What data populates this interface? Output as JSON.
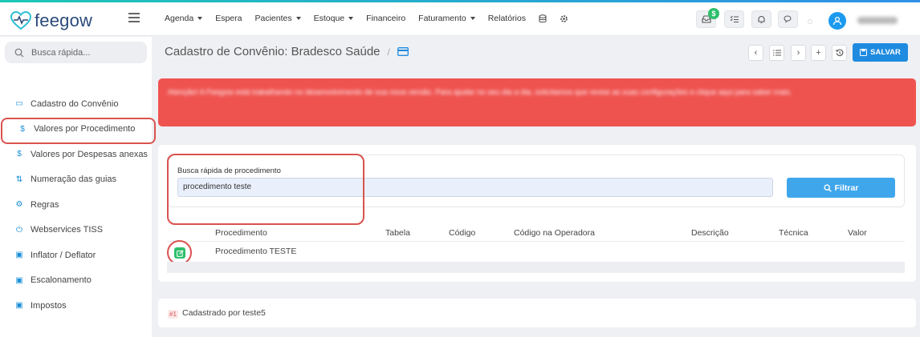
{
  "app": {
    "logo_text": "feegow"
  },
  "topnav": [
    {
      "label": "Agenda",
      "dropdown": true
    },
    {
      "label": "Espera",
      "dropdown": false
    },
    {
      "label": "Pacientes",
      "dropdown": true
    },
    {
      "label": "Estoque",
      "dropdown": true
    },
    {
      "label": "Financeiro",
      "dropdown": false
    },
    {
      "label": "Faturamento",
      "dropdown": true
    },
    {
      "label": "Relatórios",
      "dropdown": false
    }
  ],
  "topbar": {
    "notification_badge": "$"
  },
  "sidebar": {
    "search_placeholder": "Busca rápida...",
    "items": [
      {
        "label": "Cadastro do Convênio",
        "icon": "card-icon",
        "glyph": "▭",
        "active": false
      },
      {
        "label": "Valores por Procedimento",
        "icon": "dollar-icon",
        "glyph": "$",
        "active": true
      },
      {
        "label": "Valores por Despesas anexas",
        "icon": "dollar-icon",
        "glyph": "$",
        "active": false
      },
      {
        "label": "Numeração das guias",
        "icon": "sort-icon",
        "glyph": "⇅",
        "active": false
      },
      {
        "label": "Regras",
        "icon": "cogs-icon",
        "glyph": "⚙",
        "active": false
      },
      {
        "label": "Webservices TISS",
        "icon": "plug-icon",
        "glyph": "⏻",
        "active": false
      },
      {
        "label": "Inflator / Deflator",
        "icon": "money-icon",
        "glyph": "▣",
        "active": false
      },
      {
        "label": "Escalonamento",
        "icon": "money-icon",
        "glyph": "▣",
        "active": false
      },
      {
        "label": "Impostos",
        "icon": "money-icon",
        "glyph": "▣",
        "active": false
      }
    ]
  },
  "header": {
    "title": "Cadastro de Convênio: Bradesco Saúde",
    "separator": "/",
    "save_label": "SALVAR"
  },
  "alert": {
    "text": "Atenção! A Feegow está trabalhando no desenvolvimento de sua nova versão. Para ajudar no seu dia a dia, solicitamos que revise as suas configurações e clique aqui para saber mais."
  },
  "filter": {
    "label": "Busca rápida de procedimento",
    "value": "procedimento teste",
    "button_label": "Filtrar"
  },
  "table": {
    "columns": [
      "Procedimento",
      "Tabela",
      "Código",
      "Código na Operadora",
      "Descrição",
      "Técnica",
      "Valor"
    ],
    "rows": [
      {
        "procedimento": "Procedimento TESTE",
        "tabela": "",
        "codigo": "",
        "codigo_operadora": "",
        "descricao": "",
        "tecnica": "",
        "valor": ""
      }
    ]
  },
  "footer": {
    "number": "#1",
    "created_by": "Cadastrado por teste5"
  },
  "colors": {
    "accent": "#1f8be0",
    "danger": "#d9534f",
    "success": "#2dbf6c",
    "alert_bg": "#ef5350"
  }
}
